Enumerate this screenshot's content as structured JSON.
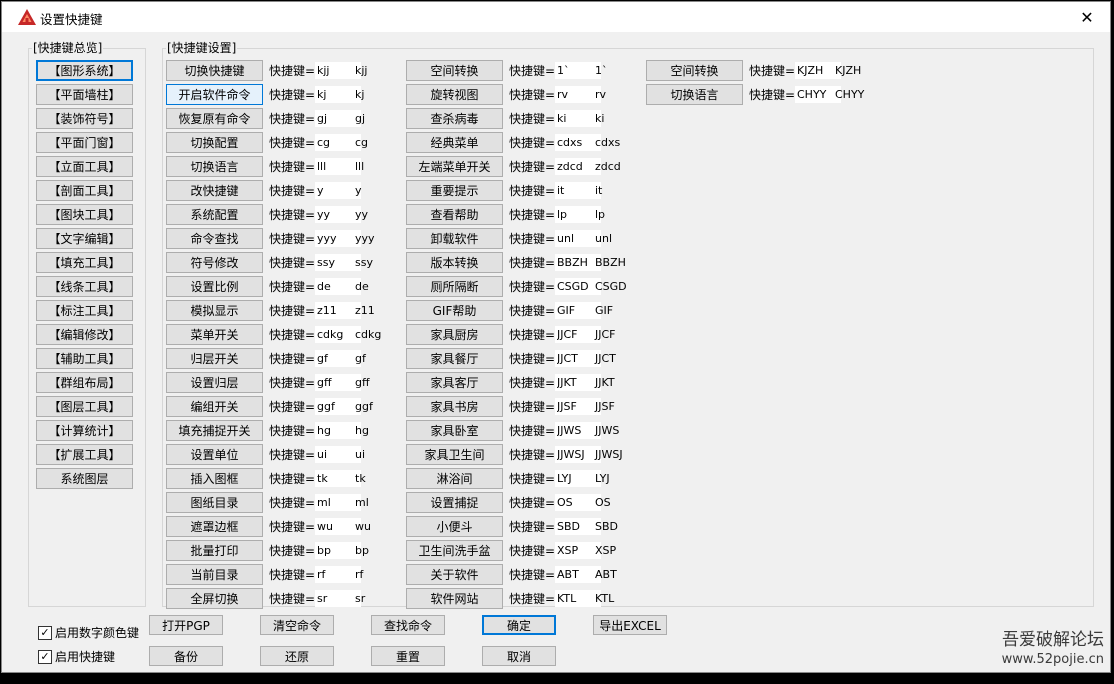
{
  "window": {
    "title": "设置快捷键",
    "close_glyph": "✕",
    "accent_color": "#0078d7"
  },
  "overview": {
    "group_title": "[快捷键总览]",
    "items": [
      "【图形系统】",
      "【平面墙柱】",
      "【装饰符号】",
      "【平面门窗】",
      "【立面工具】",
      "【剖面工具】",
      "【图块工具】",
      "【文字编辑】",
      "【填充工具】",
      "【线条工具】",
      "【标注工具】",
      "【编辑修改】",
      "【辅助工具】",
      "【群组布局】",
      "【图层工具】",
      "【计算统计】",
      "【扩展工具】",
      "系统图层"
    ]
  },
  "settings": {
    "group_title": "[快捷键设置]",
    "shortcut_label": "快捷键=",
    "col1": [
      {
        "name": "切换快捷键",
        "input": "kjj",
        "value": "kjj"
      },
      {
        "name": "开启软件命令",
        "input": "kj",
        "value": "kj"
      },
      {
        "name": "恢复原有命令",
        "input": "gj",
        "value": "gj"
      },
      {
        "name": "切换配置",
        "input": "cg",
        "value": "cg"
      },
      {
        "name": "切换语言",
        "input": "lll",
        "value": "lll"
      },
      {
        "name": "改快捷键",
        "input": "y",
        "value": "y"
      },
      {
        "name": "系统配置",
        "input": "yy",
        "value": "yy"
      },
      {
        "name": "命令查找",
        "input": "yyy",
        "value": "yyy"
      },
      {
        "name": "符号修改",
        "input": "ssy",
        "value": "ssy"
      },
      {
        "name": "设置比例",
        "input": "de",
        "value": "de"
      },
      {
        "name": "模拟显示",
        "input": "z11",
        "value": "z11"
      },
      {
        "name": "菜单开关",
        "input": "cdkg",
        "value": "cdkg"
      },
      {
        "name": "归层开关",
        "input": "gf",
        "value": "gf"
      },
      {
        "name": "设置归层",
        "input": "gff",
        "value": "gff"
      },
      {
        "name": "编组开关",
        "input": "ggf",
        "value": "ggf"
      },
      {
        "name": "填充捕捉开关",
        "input": "hg",
        "value": "hg"
      },
      {
        "name": "设置单位",
        "input": "ui",
        "value": "ui"
      },
      {
        "name": "插入图框",
        "input": "tk",
        "value": "tk"
      },
      {
        "name": "图纸目录",
        "input": "ml",
        "value": "ml"
      },
      {
        "name": "遮罩边框",
        "input": "wu",
        "value": "wu"
      },
      {
        "name": "批量打印",
        "input": "bp",
        "value": "bp"
      },
      {
        "name": "当前目录",
        "input": "rf",
        "value": "rf"
      },
      {
        "name": "全屏切换",
        "input": "sr",
        "value": "sr"
      }
    ],
    "col2": [
      {
        "name": "空间转换",
        "input": "1`",
        "value": "1`"
      },
      {
        "name": "旋转视图",
        "input": "rv",
        "value": "rv"
      },
      {
        "name": "查杀病毒",
        "input": "ki",
        "value": "ki"
      },
      {
        "name": "经典菜单",
        "input": "cdxs",
        "value": "cdxs"
      },
      {
        "name": "左端菜单开关",
        "input": "zdcd",
        "value": "zdcd"
      },
      {
        "name": "重要提示",
        "input": "it",
        "value": "it"
      },
      {
        "name": "查看帮助",
        "input": "lp",
        "value": "lp"
      },
      {
        "name": "卸载软件",
        "input": "unl",
        "value": "unl"
      },
      {
        "name": "版本转换",
        "input": "BBZH",
        "value": "BBZH"
      },
      {
        "name": "厕所隔断",
        "input": "CSGD",
        "value": "CSGD"
      },
      {
        "name": "GIF帮助",
        "input": "GIF",
        "value": "GIF"
      },
      {
        "name": "家具厨房",
        "input": "JJCF",
        "value": "JJCF"
      },
      {
        "name": "家具餐厅",
        "input": "JJCT",
        "value": "JJCT"
      },
      {
        "name": "家具客厅",
        "input": "JJKT",
        "value": "JJKT"
      },
      {
        "name": "家具书房",
        "input": "JJSF",
        "value": "JJSF"
      },
      {
        "name": "家具卧室",
        "input": "JJWS",
        "value": "JJWS"
      },
      {
        "name": "家具卫生间",
        "input": "JJWSJ",
        "value": "JJWSJ"
      },
      {
        "name": "淋浴间",
        "input": "LYJ",
        "value": "LYJ"
      },
      {
        "name": "设置捕捉",
        "input": "OS",
        "value": "OS"
      },
      {
        "name": "小便斗",
        "input": "SBD",
        "value": "SBD"
      },
      {
        "name": "卫生间洗手盆",
        "input": "XSP",
        "value": "XSP"
      },
      {
        "name": "关于软件",
        "input": "ABT",
        "value": "ABT"
      },
      {
        "name": "软件网站",
        "input": "KTL",
        "value": "KTL"
      }
    ],
    "col3": [
      {
        "name": "空间转换",
        "input": "KJZH",
        "value": "KJZH"
      },
      {
        "name": "切换语言",
        "input": "CHYY",
        "value": "CHYY"
      }
    ]
  },
  "footer": {
    "checkboxes": [
      {
        "label": "启用数字颜色键",
        "checked": true
      },
      {
        "label": "启用快捷键",
        "checked": true
      }
    ],
    "row1": [
      "打开PGP",
      "清空命令",
      "查找命令",
      "确定",
      "导出EXCEL"
    ],
    "row2": [
      "备份",
      "还原",
      "重置",
      "取消"
    ],
    "check_glyph": "✓"
  },
  "watermark": {
    "line1": "吾爱破解论坛",
    "line2": "www.52pojie.cn"
  }
}
